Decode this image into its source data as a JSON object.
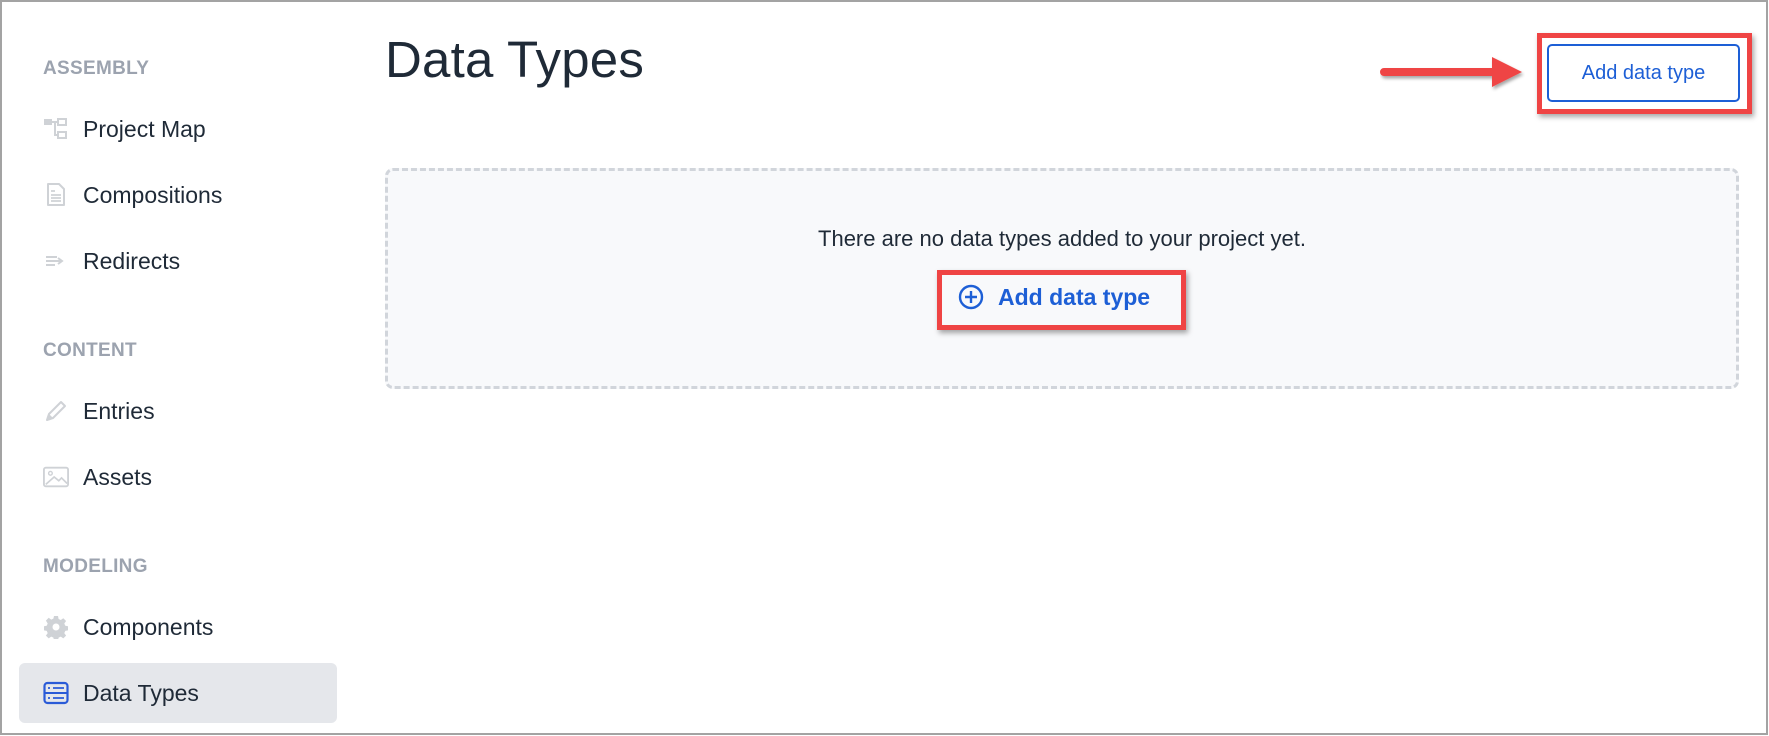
{
  "page": {
    "title": "Data Types"
  },
  "header": {
    "add_button_label": "Add data type"
  },
  "sidebar": {
    "sections": [
      {
        "label": "ASSEMBLY",
        "items": [
          {
            "label": "Project Map",
            "icon": "project-map-icon",
            "active": false
          },
          {
            "label": "Compositions",
            "icon": "document-icon",
            "active": false
          },
          {
            "label": "Redirects",
            "icon": "redirect-icon",
            "active": false
          }
        ]
      },
      {
        "label": "CONTENT",
        "items": [
          {
            "label": "Entries",
            "icon": "pencil-icon",
            "active": false
          },
          {
            "label": "Assets",
            "icon": "image-icon",
            "active": false
          }
        ]
      },
      {
        "label": "MODELING",
        "items": [
          {
            "label": "Components",
            "icon": "gear-icon",
            "active": false
          },
          {
            "label": "Data Types",
            "icon": "server-list-icon",
            "active": true
          }
        ]
      }
    ]
  },
  "empty_state": {
    "message": "There are no data types added to your project yet.",
    "button_label": "Add data type",
    "button_icon": "plus-circle-icon"
  },
  "annotations": {
    "highlight_color": "#ef4444",
    "arrow_color": "#ef4444"
  },
  "colors": {
    "accent": "#1d5fd6",
    "active_nav_bg": "#e5e7eb",
    "section_label": "#9ca3af",
    "text": "#1f2a37"
  }
}
